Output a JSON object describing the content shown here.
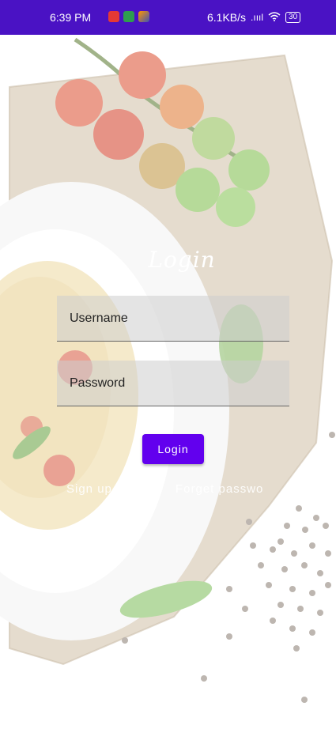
{
  "status_bar": {
    "time": "6:39 PM",
    "net_speed": "6.1KB/s",
    "signal": ".ıııl",
    "battery": "30",
    "left_icons": [
      "youtube-icon",
      "phone-icon",
      "app-icon"
    ]
  },
  "login": {
    "title": "Login",
    "username_placeholder": "Username",
    "password_placeholder": "Password",
    "login_button": "Login",
    "signup_link": "Sign up",
    "forgot_link": "Forget password"
  },
  "colors": {
    "status_bar": "#4a12c4",
    "accent": "#6200ee"
  }
}
